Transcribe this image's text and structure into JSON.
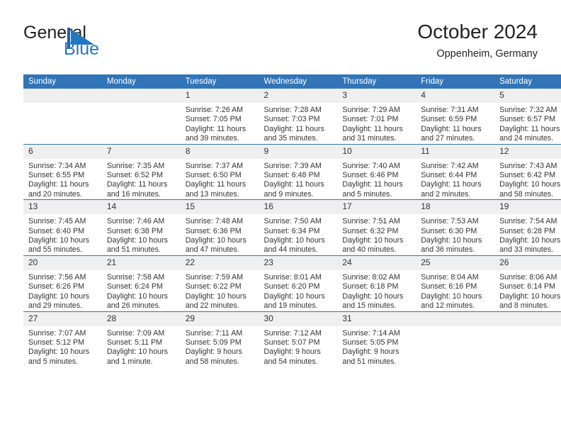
{
  "brand": {
    "name_part1": "General",
    "name_part2": "Blue",
    "mark": "triangle-flag-logo",
    "accent_color": "#1f78c1"
  },
  "header": {
    "title": "October 2024",
    "subtitle": "Oppenheim, Germany"
  },
  "theme": {
    "header_blue": "#3175b8",
    "daynum_band": "#efefef",
    "text": "#333333"
  },
  "weekdays": [
    "Sunday",
    "Monday",
    "Tuesday",
    "Wednesday",
    "Thursday",
    "Friday",
    "Saturday"
  ],
  "labels": {
    "sunrise_prefix": "Sunrise:",
    "sunset_prefix": "Sunset:",
    "daylight_prefix": "Daylight:"
  },
  "weeks": [
    [
      {
        "day": "",
        "blank": true
      },
      {
        "day": "",
        "blank": true
      },
      {
        "day": "1",
        "sunrise": "Sunrise: 7:26 AM",
        "sunset": "Sunset: 7:05 PM",
        "daylight1": "Daylight: 11 hours",
        "daylight2": "and 39 minutes."
      },
      {
        "day": "2",
        "sunrise": "Sunrise: 7:28 AM",
        "sunset": "Sunset: 7:03 PM",
        "daylight1": "Daylight: 11 hours",
        "daylight2": "and 35 minutes."
      },
      {
        "day": "3",
        "sunrise": "Sunrise: 7:29 AM",
        "sunset": "Sunset: 7:01 PM",
        "daylight1": "Daylight: 11 hours",
        "daylight2": "and 31 minutes."
      },
      {
        "day": "4",
        "sunrise": "Sunrise: 7:31 AM",
        "sunset": "Sunset: 6:59 PM",
        "daylight1": "Daylight: 11 hours",
        "daylight2": "and 27 minutes."
      },
      {
        "day": "5",
        "sunrise": "Sunrise: 7:32 AM",
        "sunset": "Sunset: 6:57 PM",
        "daylight1": "Daylight: 11 hours",
        "daylight2": "and 24 minutes."
      }
    ],
    [
      {
        "day": "6",
        "sunrise": "Sunrise: 7:34 AM",
        "sunset": "Sunset: 6:55 PM",
        "daylight1": "Daylight: 11 hours",
        "daylight2": "and 20 minutes."
      },
      {
        "day": "7",
        "sunrise": "Sunrise: 7:35 AM",
        "sunset": "Sunset: 6:52 PM",
        "daylight1": "Daylight: 11 hours",
        "daylight2": "and 16 minutes."
      },
      {
        "day": "8",
        "sunrise": "Sunrise: 7:37 AM",
        "sunset": "Sunset: 6:50 PM",
        "daylight1": "Daylight: 11 hours",
        "daylight2": "and 13 minutes."
      },
      {
        "day": "9",
        "sunrise": "Sunrise: 7:39 AM",
        "sunset": "Sunset: 6:48 PM",
        "daylight1": "Daylight: 11 hours",
        "daylight2": "and 9 minutes."
      },
      {
        "day": "10",
        "sunrise": "Sunrise: 7:40 AM",
        "sunset": "Sunset: 6:46 PM",
        "daylight1": "Daylight: 11 hours",
        "daylight2": "and 5 minutes."
      },
      {
        "day": "11",
        "sunrise": "Sunrise: 7:42 AM",
        "sunset": "Sunset: 6:44 PM",
        "daylight1": "Daylight: 11 hours",
        "daylight2": "and 2 minutes."
      },
      {
        "day": "12",
        "sunrise": "Sunrise: 7:43 AM",
        "sunset": "Sunset: 6:42 PM",
        "daylight1": "Daylight: 10 hours",
        "daylight2": "and 58 minutes."
      }
    ],
    [
      {
        "day": "13",
        "sunrise": "Sunrise: 7:45 AM",
        "sunset": "Sunset: 6:40 PM",
        "daylight1": "Daylight: 10 hours",
        "daylight2": "and 55 minutes."
      },
      {
        "day": "14",
        "sunrise": "Sunrise: 7:46 AM",
        "sunset": "Sunset: 6:38 PM",
        "daylight1": "Daylight: 10 hours",
        "daylight2": "and 51 minutes."
      },
      {
        "day": "15",
        "sunrise": "Sunrise: 7:48 AM",
        "sunset": "Sunset: 6:36 PM",
        "daylight1": "Daylight: 10 hours",
        "daylight2": "and 47 minutes."
      },
      {
        "day": "16",
        "sunrise": "Sunrise: 7:50 AM",
        "sunset": "Sunset: 6:34 PM",
        "daylight1": "Daylight: 10 hours",
        "daylight2": "and 44 minutes."
      },
      {
        "day": "17",
        "sunrise": "Sunrise: 7:51 AM",
        "sunset": "Sunset: 6:32 PM",
        "daylight1": "Daylight: 10 hours",
        "daylight2": "and 40 minutes."
      },
      {
        "day": "18",
        "sunrise": "Sunrise: 7:53 AM",
        "sunset": "Sunset: 6:30 PM",
        "daylight1": "Daylight: 10 hours",
        "daylight2": "and 36 minutes."
      },
      {
        "day": "19",
        "sunrise": "Sunrise: 7:54 AM",
        "sunset": "Sunset: 6:28 PM",
        "daylight1": "Daylight: 10 hours",
        "daylight2": "and 33 minutes."
      }
    ],
    [
      {
        "day": "20",
        "sunrise": "Sunrise: 7:56 AM",
        "sunset": "Sunset: 6:26 PM",
        "daylight1": "Daylight: 10 hours",
        "daylight2": "and 29 minutes."
      },
      {
        "day": "21",
        "sunrise": "Sunrise: 7:58 AM",
        "sunset": "Sunset: 6:24 PM",
        "daylight1": "Daylight: 10 hours",
        "daylight2": "and 26 minutes."
      },
      {
        "day": "22",
        "sunrise": "Sunrise: 7:59 AM",
        "sunset": "Sunset: 6:22 PM",
        "daylight1": "Daylight: 10 hours",
        "daylight2": "and 22 minutes."
      },
      {
        "day": "23",
        "sunrise": "Sunrise: 8:01 AM",
        "sunset": "Sunset: 6:20 PM",
        "daylight1": "Daylight: 10 hours",
        "daylight2": "and 19 minutes."
      },
      {
        "day": "24",
        "sunrise": "Sunrise: 8:02 AM",
        "sunset": "Sunset: 6:18 PM",
        "daylight1": "Daylight: 10 hours",
        "daylight2": "and 15 minutes."
      },
      {
        "day": "25",
        "sunrise": "Sunrise: 8:04 AM",
        "sunset": "Sunset: 6:16 PM",
        "daylight1": "Daylight: 10 hours",
        "daylight2": "and 12 minutes."
      },
      {
        "day": "26",
        "sunrise": "Sunrise: 8:06 AM",
        "sunset": "Sunset: 6:14 PM",
        "daylight1": "Daylight: 10 hours",
        "daylight2": "and 8 minutes."
      }
    ],
    [
      {
        "day": "27",
        "sunrise": "Sunrise: 7:07 AM",
        "sunset": "Sunset: 5:12 PM",
        "daylight1": "Daylight: 10 hours",
        "daylight2": "and 5 minutes."
      },
      {
        "day": "28",
        "sunrise": "Sunrise: 7:09 AM",
        "sunset": "Sunset: 5:11 PM",
        "daylight1": "Daylight: 10 hours",
        "daylight2": "and 1 minute."
      },
      {
        "day": "29",
        "sunrise": "Sunrise: 7:11 AM",
        "sunset": "Sunset: 5:09 PM",
        "daylight1": "Daylight: 9 hours",
        "daylight2": "and 58 minutes."
      },
      {
        "day": "30",
        "sunrise": "Sunrise: 7:12 AM",
        "sunset": "Sunset: 5:07 PM",
        "daylight1": "Daylight: 9 hours",
        "daylight2": "and 54 minutes."
      },
      {
        "day": "31",
        "sunrise": "Sunrise: 7:14 AM",
        "sunset": "Sunset: 5:05 PM",
        "daylight1": "Daylight: 9 hours",
        "daylight2": "and 51 minutes."
      },
      {
        "day": "",
        "blank": true
      },
      {
        "day": "",
        "blank": true
      }
    ]
  ]
}
